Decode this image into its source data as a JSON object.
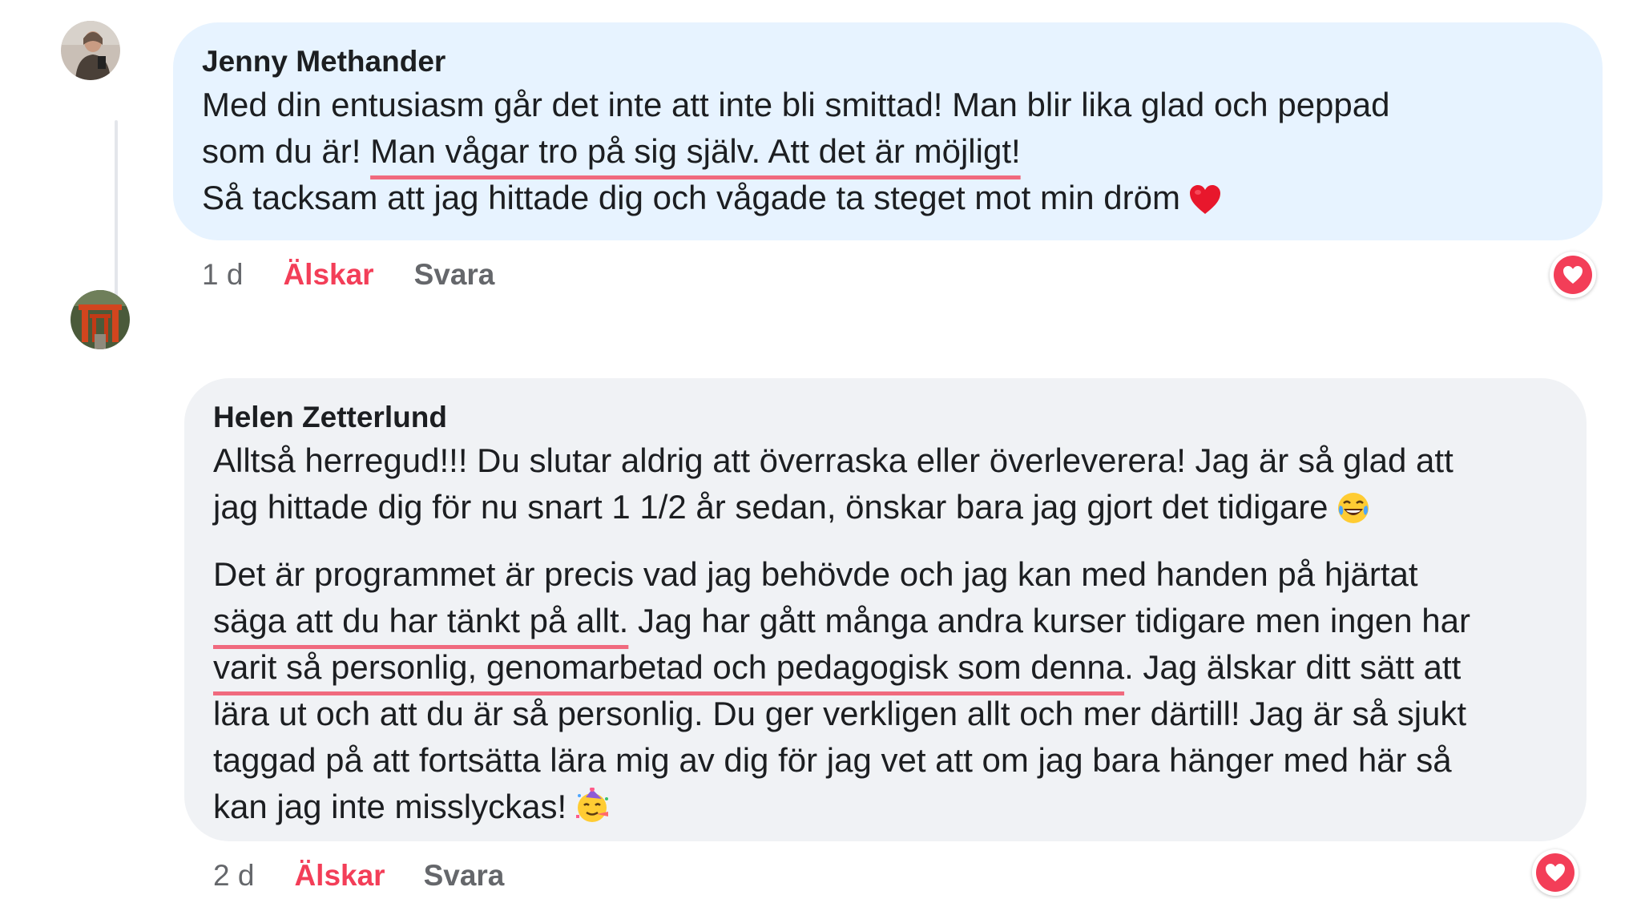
{
  "comments": [
    {
      "author": "Jenny Methander",
      "lines": [
        {
          "before": "Med din entusiasm går det inte att inte bli smittad! Man blir lika glad och peppad"
        },
        {
          "before": "som du är! ",
          "underlined": "Man vågar tro på sig själv. Att det är möjligt!"
        },
        {
          "before": "Så tacksam att jag hittade dig och vågade ta steget mot min dröm"
        }
      ],
      "emoji": "red-heart",
      "time": "1 d",
      "love_label": "Älskar",
      "reply_label": "Svara",
      "reaction": "love-reaction"
    },
    {
      "author": "Helen Zetterlund",
      "paragraph1": [
        "Alltså herregud!!! Du slutar aldrig att överraska eller överleverera! Jag är så glad att",
        "jag hittade dig för nu snart 1 1/2 år sedan, önskar bara jag gjort det tidigare"
      ],
      "paragraph2": [
        {
          "before": "Det är programmet är precis vad jag behövde och jag kan med handen på hjärtat"
        },
        {
          "underlined": "säga att du har tänkt på allt.",
          "after": " Jag har gått många andra kurser tidigare men ingen har"
        },
        {
          "underlined": "varit så personlig, genomarbetad och pedagogisk som denna",
          "after": ". Jag älskar ditt sätt att"
        },
        {
          "before": "lära ut och att du är så personlig. Du ger verkligen allt och mer därtill! Jag är så sjukt"
        },
        {
          "before": "taggad på att fortsätta lära mig av dig för jag vet att om jag bara hänger med här så"
        },
        {
          "before": "kan jag inte misslyckas!"
        }
      ],
      "emoji1": "laughing-tears",
      "emoji2": "partying-face",
      "time": "2 d",
      "love_label": "Älskar",
      "reply_label": "Svara",
      "reaction": "love-reaction"
    }
  ],
  "colors": {
    "bubble1": "#e7f3ff",
    "bubble2": "#f0f2f5",
    "love": "#f33e58",
    "underline": "#f06a7e",
    "meta": "#65676b"
  }
}
